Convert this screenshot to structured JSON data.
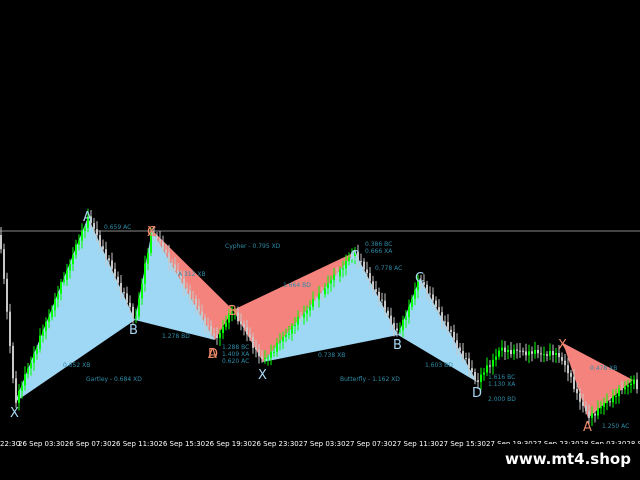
{
  "chart": {
    "level_line": 1.0,
    "colors": {
      "background": "#000000",
      "bull_candle": "#00ff00",
      "bear_candle": "#c8c8c8",
      "pattern_blue": "#9fd8f5",
      "pattern_red": "#f4837d",
      "point_blue": "#a9d7f2",
      "point_red": "#f08a6a",
      "ratio_text": "#2f8ca8",
      "axis_text": "#ffffff",
      "level_line": "#8a8a8a"
    }
  },
  "time_axis": [
    "22:30",
    "26 Sep 03:30",
    "26 Sep 07:30",
    "26 Sep 11:30",
    "26 Sep 15:30",
    "26 Sep 19:30",
    "26 Sep 23:30",
    "27 Sep 03:30",
    "27 Sep 07:30",
    "27 Sep 11:30",
    "27 Sep 15:30",
    "27 Sep 19:30",
    "27 Sep 23:30",
    "28 Sep 03:30",
    "28 Sep 07"
  ],
  "patterns": [
    {
      "name": "Gartley - 0.684 XD",
      "color": "blue",
      "points": [
        {
          "label": "X"
        },
        {
          "label": "A"
        },
        {
          "label": "B"
        },
        {
          "label": "C"
        },
        {
          "label": "D"
        }
      ],
      "ratios": [
        "0.659 AC",
        "0.652 XB",
        "1.278 BD"
      ]
    },
    {
      "name": "Cypher - 0.795 XD",
      "color": "red",
      "points": [
        {
          "label": "X"
        },
        {
          "label": "A"
        },
        {
          "label": "B"
        },
        {
          "label": "C"
        }
      ],
      "ratios": [
        "A 312 XB",
        "1.664 BD",
        "1.288 BC",
        "1.409 XA",
        "0.620 AC"
      ]
    },
    {
      "name": "Butterfly - 1.162 XD",
      "color": "blue",
      "points": [
        {
          "label": "X"
        },
        {
          "label": "A"
        },
        {
          "label": "B"
        },
        {
          "label": "C"
        },
        {
          "label": "D"
        }
      ],
      "ratios": [
        "0.738 XB",
        "1.603 BD",
        "1.616 BC",
        "1.130 XA",
        "2.000 BD",
        "0.386 BC",
        "0.666 XA",
        "0.778 AC"
      ]
    },
    {
      "name": "",
      "color": "red",
      "points": [
        {
          "label": "X"
        },
        {
          "label": "A"
        }
      ],
      "ratios": [
        "0.478 XB",
        "1.250 AC"
      ]
    }
  ],
  "watermark": "www.mt4.shop"
}
